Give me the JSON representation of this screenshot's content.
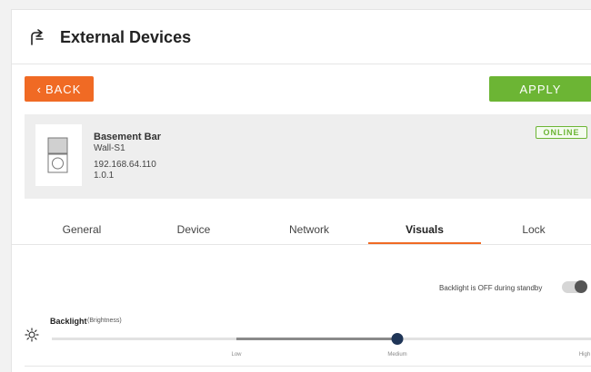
{
  "header": {
    "title": "External Devices",
    "icon": "external-devices-icon"
  },
  "toolbar": {
    "back_label": "BACK",
    "apply_label": "APPLY"
  },
  "device": {
    "name": "Basement Bar",
    "model": "Wall-S1",
    "ip": "192.168.64.110",
    "version": "1.0.1",
    "status": "ONLINE"
  },
  "tabs": [
    {
      "label": "General",
      "active": false
    },
    {
      "label": "Device",
      "active": false
    },
    {
      "label": "Network",
      "active": false
    },
    {
      "label": "Visuals",
      "active": true
    },
    {
      "label": "Lock",
      "active": false
    }
  ],
  "visuals": {
    "standby_label": "Backlight is OFF during standby",
    "standby_enabled": true,
    "backlight": {
      "title": "Backlight",
      "subtitle": "(Brightness)",
      "levels": [
        "Low",
        "Medium",
        "High"
      ],
      "value": "Medium"
    }
  },
  "colors": {
    "accent_orange": "#f06a24",
    "accent_green": "#6cb534",
    "slider_thumb": "#1f3557"
  }
}
